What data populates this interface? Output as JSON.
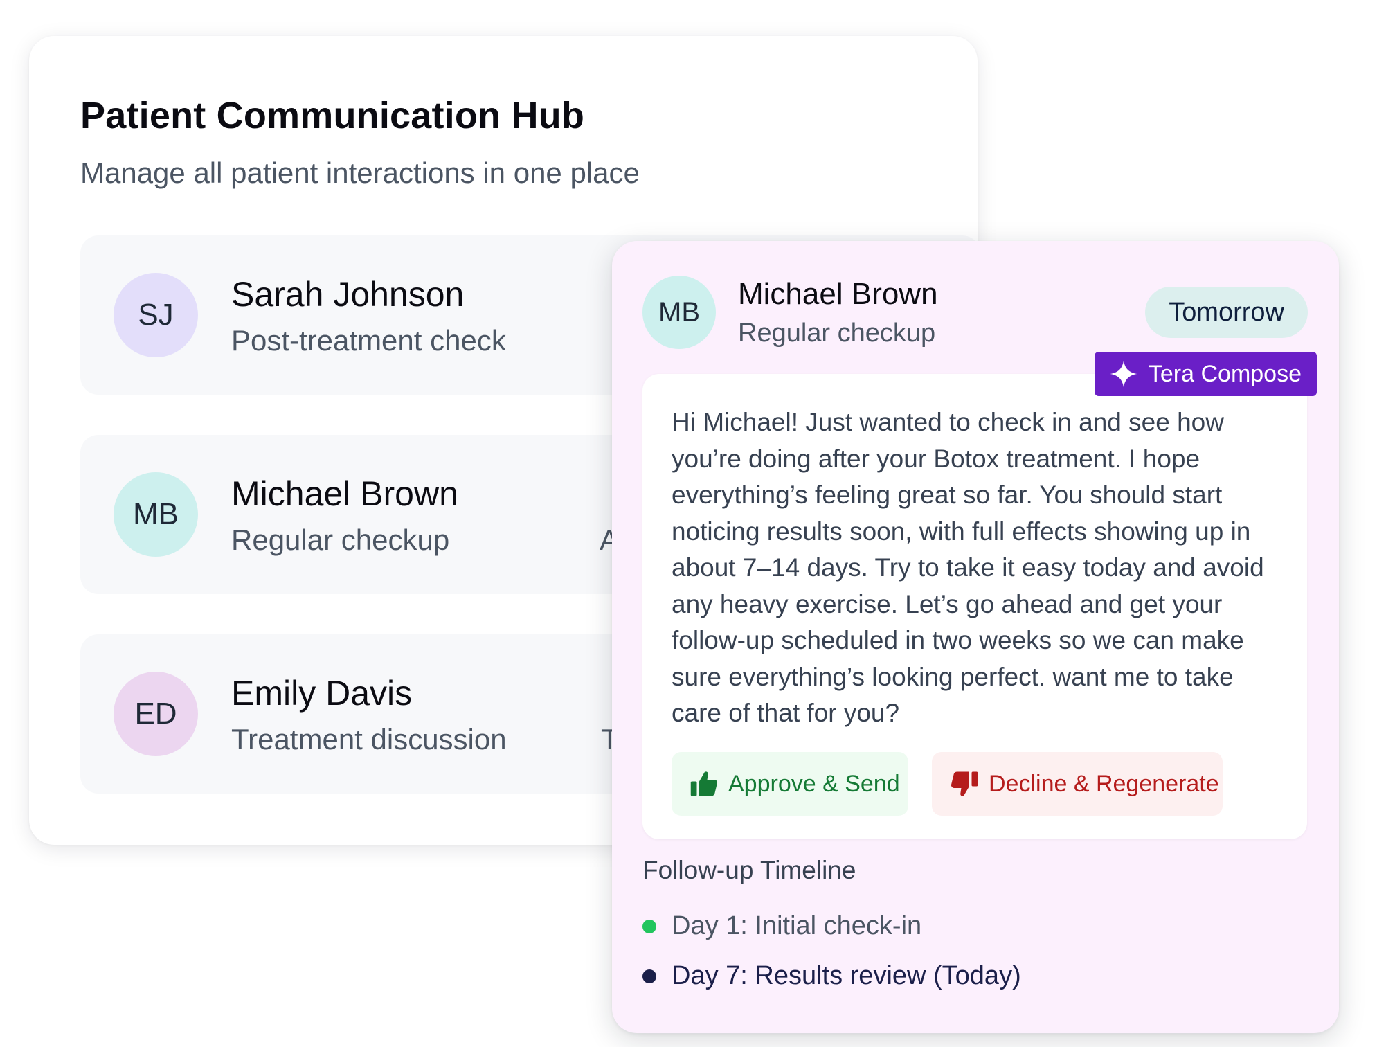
{
  "hub": {
    "title": "Patient Communication Hub",
    "subtitle": "Manage all patient interactions in one place",
    "patients": [
      {
        "initials": "SJ",
        "name": "Sarah Johnson",
        "reason": "Post-treatment check",
        "extra": "",
        "avatar_color": "#e3defa"
      },
      {
        "initials": "MB",
        "name": "Michael Brown",
        "reason": "Regular checkup",
        "extra": "Ap",
        "avatar_color": "#cdf0ee"
      },
      {
        "initials": "ED",
        "name": "Emily Davis",
        "reason": "Treatment discussion",
        "extra": "Tre",
        "avatar_color": "#ecd6f0"
      }
    ]
  },
  "detail": {
    "initials": "MB",
    "name": "Michael Brown",
    "reason": "Regular checkup",
    "when": "Tomorrow",
    "compose_label": "Tera Compose",
    "compose_icon": "sparkle-icon",
    "message": "Hi Michael! Just wanted to check in and see how you’re doing after your Botox treatment. I hope everything’s feeling great so far. You should start noticing results soon, with full effects showing up in about 7–14 days. Try to take it easy today and avoid any heavy exercise. Let’s go ahead and get your follow-up scheduled in two weeks so we can make sure everything’s looking perfect. want me to take care of that for you?",
    "approve_label": "Approve & Send",
    "approve_icon": "thumbs-up-icon",
    "decline_label": "Decline & Regenerate",
    "decline_icon": "thumbs-down-icon",
    "timeline_title": "Follow-up Timeline",
    "timeline": [
      {
        "label": "Day 1: Initial check-in",
        "dot_color": "#22c55e"
      },
      {
        "label": "Day 7: Results review (Today)",
        "dot_color": "#1b1f4a"
      }
    ]
  },
  "colors": {
    "accent_purple": "#6a1fc7",
    "approve_green": "#157a35",
    "decline_red": "#b51c1c",
    "detail_background": "#fcf0fd"
  }
}
